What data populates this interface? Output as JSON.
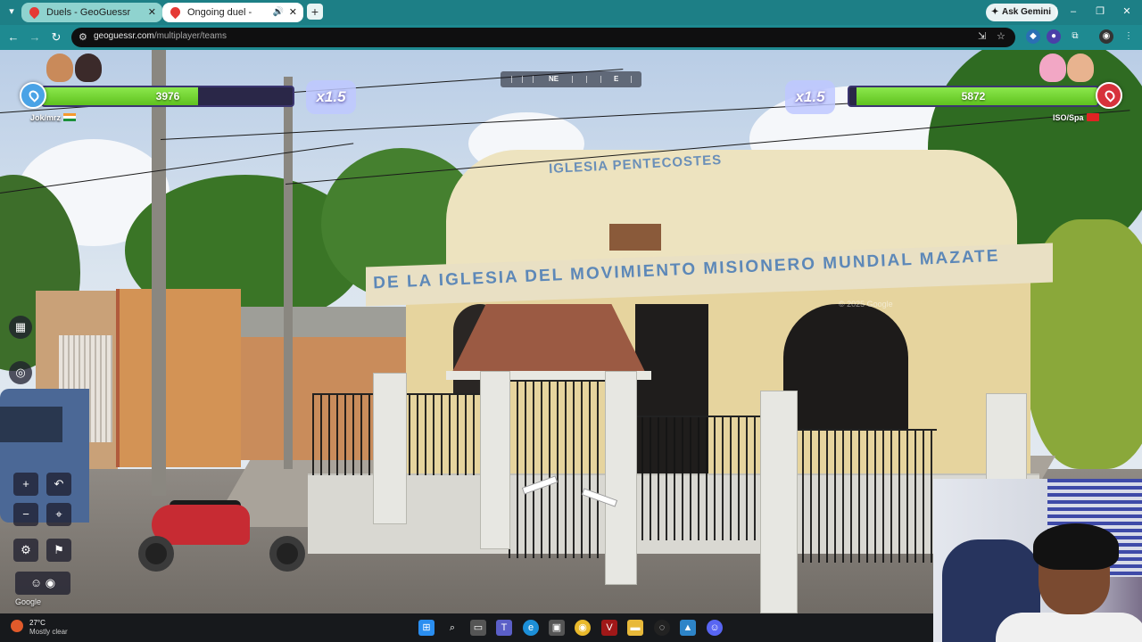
{
  "browser": {
    "tabs": [
      {
        "label": "Duels - GeoGuessr",
        "active": false
      },
      {
        "label": "Ongoing duel - GeoGuessr",
        "active": true
      }
    ],
    "ask_gemini": "Ask Gemini",
    "url_host": "geoguessr.com",
    "url_path": "/multiplayer/teams",
    "colors": {
      "tabbar": "#1d7f86",
      "toolbar": "#1e8a91",
      "omnibox": "#0f0f10"
    }
  },
  "duel": {
    "left_team": {
      "name": "Jok/mrz",
      "health": "3976",
      "health_fraction": 0.62,
      "multiplier": "x1.5",
      "color": "#4aa3e6"
    },
    "right_team": {
      "name": "ISO/Spa",
      "health": "5872",
      "health_fraction": 0.97,
      "multiplier": "x1.5",
      "color": "#d7323b"
    },
    "health_color": "#6fd22e",
    "compass": {
      "labels": [
        "NE",
        "E"
      ]
    }
  },
  "scene": {
    "sign_top": "IGLESIA PENTECOSTES",
    "sign_band": "DE LA IGLESIA DEL MOVIMIENTO MISIONERO MUNDIAL MAZATE",
    "watermark": "© 2025 Google",
    "google_logo": "Google"
  },
  "taskbar": {
    "temperature": "27°C",
    "condition": "Mostly clear",
    "icons": [
      "start-icon",
      "search-icon",
      "task-view-icon",
      "teams-icon",
      "edge-icon",
      "store-icon",
      "chrome-icon",
      "app-icon",
      "folder-icon",
      "app2-icon",
      "photos-icon",
      "discord-icon"
    ]
  }
}
